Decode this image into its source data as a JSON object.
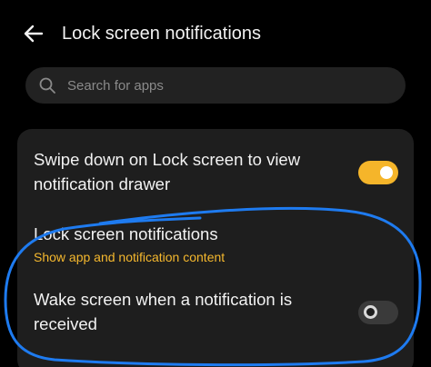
{
  "header": {
    "title": "Lock screen notifications",
    "back_icon": "arrow-left-icon"
  },
  "search": {
    "placeholder": "Search for apps",
    "icon": "search-icon"
  },
  "settings": [
    {
      "title": "Swipe down on Lock screen to view notification drawer",
      "toggle": "on"
    },
    {
      "title": "Lock screen notifications",
      "subtitle": "Show app and notification content"
    },
    {
      "title": "Wake screen when a notification is received",
      "toggle": "off"
    }
  ],
  "colors": {
    "background": "#000000",
    "card": "#1e1e1e",
    "accent": "#f5b52a",
    "subtitle": "#f5b82e",
    "annotation": "#1e7bf0"
  }
}
